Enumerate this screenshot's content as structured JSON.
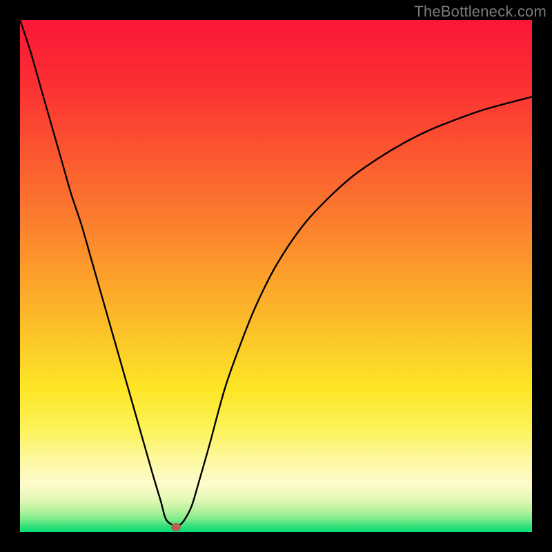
{
  "watermark": "TheBottleneck.com",
  "colors": {
    "frame": "#000000",
    "gradient_stops": [
      {
        "offset": 0.0,
        "color": "#fb1736"
      },
      {
        "offset": 0.12,
        "color": "#fb2e33"
      },
      {
        "offset": 0.25,
        "color": "#fb5430"
      },
      {
        "offset": 0.38,
        "color": "#fb7a2e"
      },
      {
        "offset": 0.5,
        "color": "#fca02b"
      },
      {
        "offset": 0.62,
        "color": "#fcc629"
      },
      {
        "offset": 0.72,
        "color": "#fde626"
      },
      {
        "offset": 0.8,
        "color": "#fdf35a"
      },
      {
        "offset": 0.86,
        "color": "#fdf8a0"
      },
      {
        "offset": 0.905,
        "color": "#fefbcc"
      },
      {
        "offset": 0.935,
        "color": "#e7f8b8"
      },
      {
        "offset": 0.958,
        "color": "#b6f29d"
      },
      {
        "offset": 0.975,
        "color": "#7ceb8a"
      },
      {
        "offset": 0.99,
        "color": "#2de079"
      },
      {
        "offset": 1.0,
        "color": "#06dd77"
      }
    ],
    "curve": "#000000",
    "marker": "#b4614f"
  },
  "chart_data": {
    "type": "line",
    "title": "",
    "xlabel": "",
    "ylabel": "",
    "xlim": [
      0,
      100
    ],
    "ylim": [
      0,
      100
    ],
    "series": [
      {
        "name": "bottleneck-curve",
        "x": [
          0,
          2,
          4,
          6,
          8,
          10,
          12,
          14,
          16,
          18,
          20,
          22,
          24,
          26,
          27.5,
          28.5,
          30,
          31,
          32,
          33.5,
          35,
          37,
          40,
          43,
          46,
          50,
          55,
          60,
          65,
          70,
          75,
          80,
          85,
          90,
          95,
          100
        ],
        "y": [
          100,
          94,
          87,
          80,
          73,
          66,
          60,
          53,
          46,
          39,
          32,
          25,
          18,
          11,
          6,
          2.5,
          1.3,
          1.3,
          2.2,
          5,
          10,
          17,
          28,
          36.5,
          44,
          52,
          59.5,
          65,
          69.5,
          73,
          76,
          78.5,
          80.5,
          82.3,
          83.7,
          85
        ]
      }
    ],
    "marker": {
      "x": 30.5,
      "y": 1.0
    },
    "legend": false,
    "grid": false
  }
}
